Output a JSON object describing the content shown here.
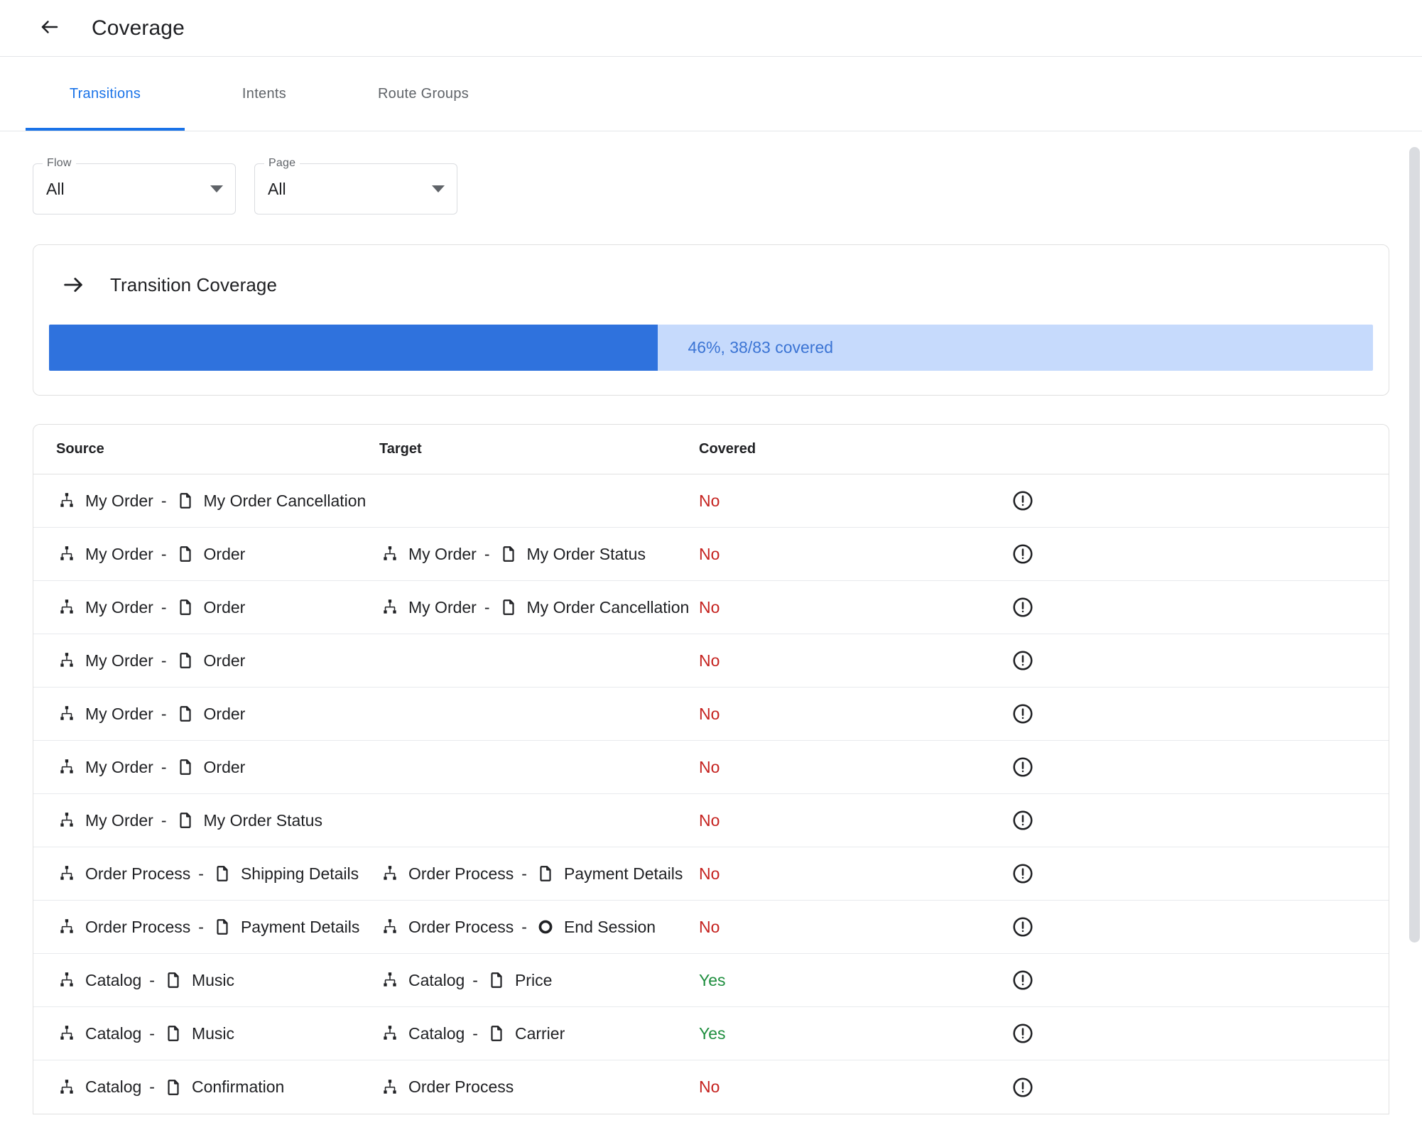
{
  "header": {
    "back_icon": "arrow-back-icon",
    "title": "Coverage"
  },
  "tabs": [
    {
      "label": "Transitions",
      "active": true
    },
    {
      "label": "Intents",
      "active": false
    },
    {
      "label": "Route Groups",
      "active": false
    }
  ],
  "filters": [
    {
      "legend": "Flow",
      "value": "All",
      "icon": "chevron-down-icon"
    },
    {
      "legend": "Page",
      "value": "All",
      "icon": "chevron-down-icon"
    }
  ],
  "coverage_card": {
    "icon": "arrow-forward-icon",
    "title": "Transition Coverage",
    "percent": 46,
    "covered_count": 38,
    "total_count": 83,
    "label": "46%, 38/83 covered",
    "fill_color": "#2f72dd",
    "track_color": "#c6dafc",
    "text_color": "#3b74d4"
  },
  "table": {
    "columns": [
      "Source",
      "Target",
      "Covered"
    ],
    "colors": {
      "yes": "#1e8e3e",
      "no": "#c5221f"
    },
    "rows": [
      {
        "source": {
          "flow": "My Order",
          "page": "My Order Cancellation",
          "flow_icon": "account-tree-icon",
          "page_icon": "page-icon"
        },
        "target": null,
        "covered": "No",
        "flag_icon": "error-outline-icon"
      },
      {
        "source": {
          "flow": "My Order",
          "page": "Order",
          "flow_icon": "account-tree-icon",
          "page_icon": "page-icon"
        },
        "target": {
          "flow": "My Order",
          "page": "My Order Status",
          "flow_icon": "account-tree-icon",
          "page_icon": "page-icon"
        },
        "covered": "No",
        "flag_icon": "error-outline-icon"
      },
      {
        "source": {
          "flow": "My Order",
          "page": "Order",
          "flow_icon": "account-tree-icon",
          "page_icon": "page-icon"
        },
        "target": {
          "flow": "My Order",
          "page": "My Order Cancellation",
          "flow_icon": "account-tree-icon",
          "page_icon": "page-icon"
        },
        "covered": "No",
        "flag_icon": "error-outline-icon"
      },
      {
        "source": {
          "flow": "My Order",
          "page": "Order",
          "flow_icon": "account-tree-icon",
          "page_icon": "page-icon"
        },
        "target": null,
        "covered": "No",
        "flag_icon": "error-outline-icon"
      },
      {
        "source": {
          "flow": "My Order",
          "page": "Order",
          "flow_icon": "account-tree-icon",
          "page_icon": "page-icon"
        },
        "target": null,
        "covered": "No",
        "flag_icon": "error-outline-icon"
      },
      {
        "source": {
          "flow": "My Order",
          "page": "Order",
          "flow_icon": "account-tree-icon",
          "page_icon": "page-icon"
        },
        "target": null,
        "covered": "No",
        "flag_icon": "error-outline-icon"
      },
      {
        "source": {
          "flow": "My Order",
          "page": "My Order Status",
          "flow_icon": "account-tree-icon",
          "page_icon": "page-icon"
        },
        "target": null,
        "covered": "No",
        "flag_icon": "error-outline-icon"
      },
      {
        "source": {
          "flow": "Order Process",
          "page": "Shipping Details",
          "flow_icon": "account-tree-icon",
          "page_icon": "page-icon"
        },
        "target": {
          "flow": "Order Process",
          "page": "Payment Details",
          "flow_icon": "account-tree-icon",
          "page_icon": "page-icon"
        },
        "covered": "No",
        "flag_icon": "error-outline-icon"
      },
      {
        "source": {
          "flow": "Order Process",
          "page": "Payment Details",
          "flow_icon": "account-tree-icon",
          "page_icon": "page-icon"
        },
        "target": {
          "flow": "Order Process",
          "page": "End Session",
          "flow_icon": "account-tree-icon",
          "page_icon": "end-session-icon"
        },
        "covered": "No",
        "flag_icon": "error-outline-icon"
      },
      {
        "source": {
          "flow": "Catalog",
          "page": "Music",
          "flow_icon": "account-tree-icon",
          "page_icon": "page-icon"
        },
        "target": {
          "flow": "Catalog",
          "page": "Price",
          "flow_icon": "account-tree-icon",
          "page_icon": "page-icon"
        },
        "covered": "Yes",
        "flag_icon": "error-outline-icon"
      },
      {
        "source": {
          "flow": "Catalog",
          "page": "Music",
          "flow_icon": "account-tree-icon",
          "page_icon": "page-icon"
        },
        "target": {
          "flow": "Catalog",
          "page": "Carrier",
          "flow_icon": "account-tree-icon",
          "page_icon": "page-icon"
        },
        "covered": "Yes",
        "flag_icon": "error-outline-icon"
      },
      {
        "source": {
          "flow": "Catalog",
          "page": "Confirmation",
          "flow_icon": "account-tree-icon",
          "page_icon": "page-icon"
        },
        "target": {
          "flow": "Order Process",
          "page": null,
          "flow_icon": "account-tree-icon",
          "page_icon": null
        },
        "covered": "No",
        "flag_icon": "error-outline-icon"
      }
    ]
  }
}
